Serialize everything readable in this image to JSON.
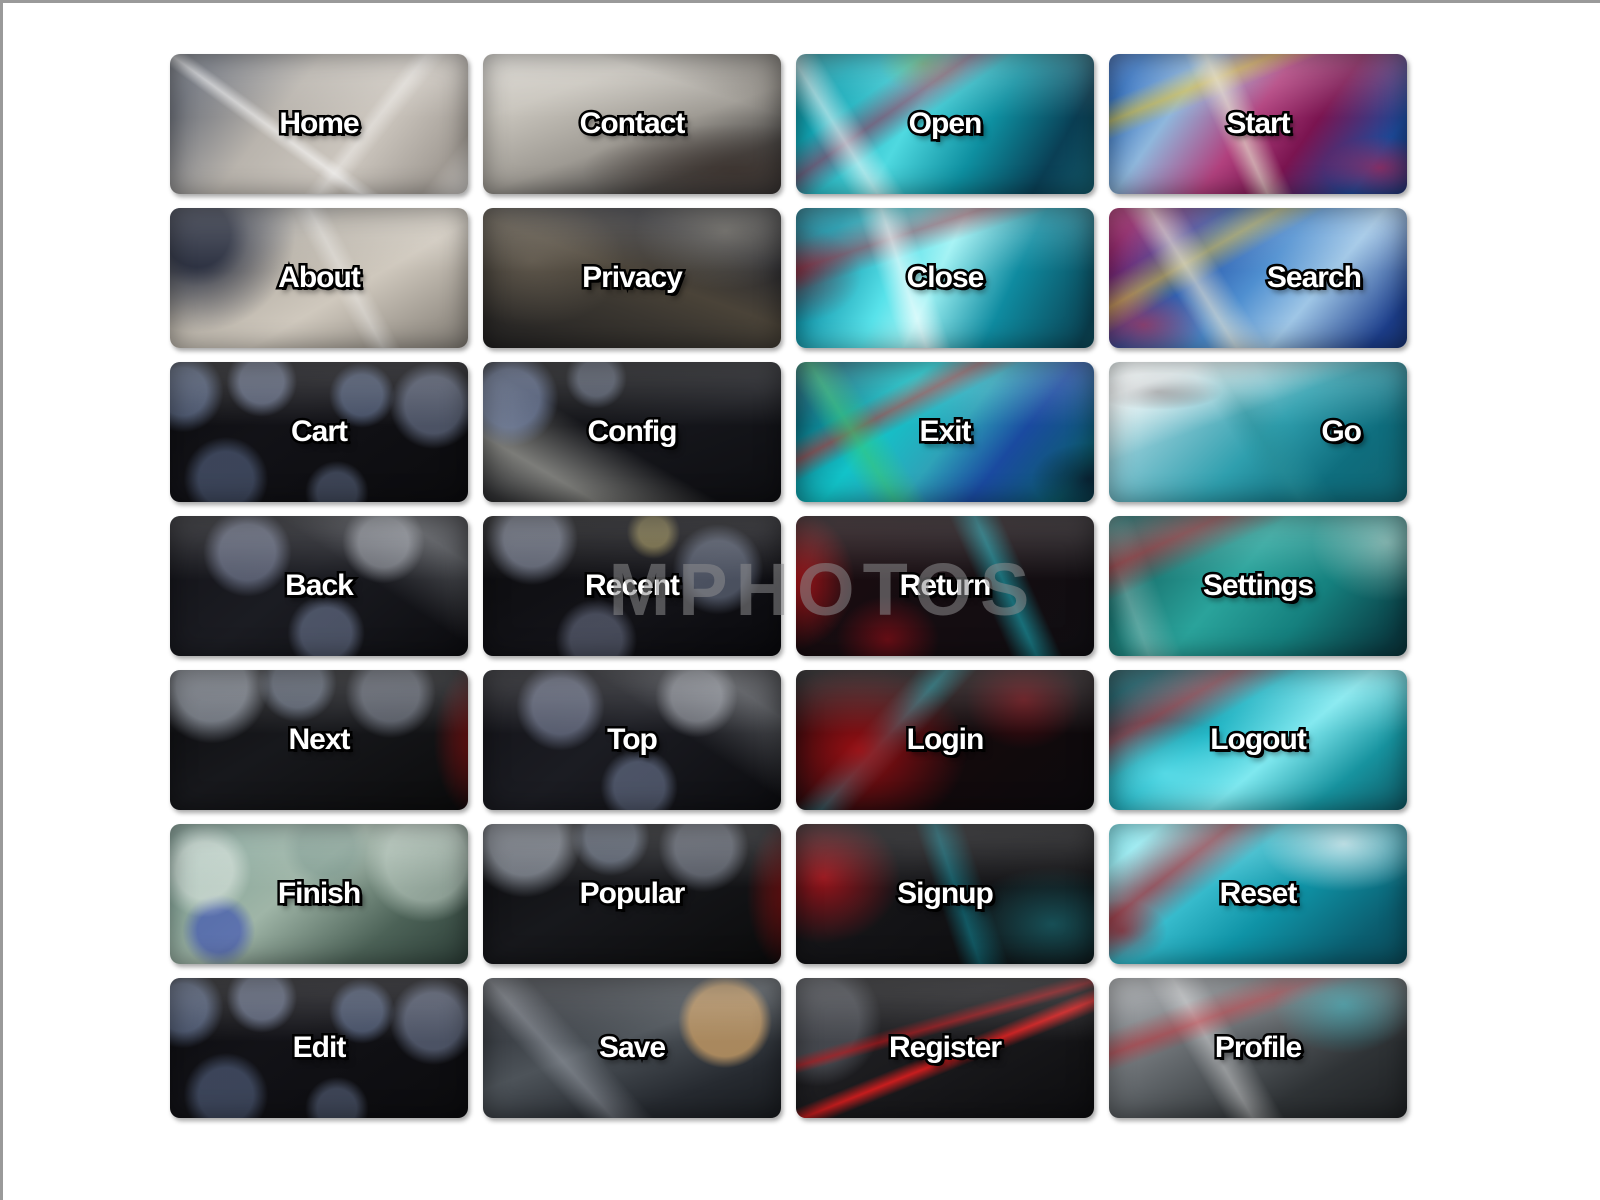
{
  "page": {
    "title": "Web Navigation Button Set",
    "background_color": "#ffffff",
    "border_color": "#9a9a9a",
    "text_color": "#ffffff",
    "text_outline_color": "#000000",
    "columns": 4,
    "rows": 7,
    "button_count": 28
  },
  "watermark": {
    "text": "MPHOTOS",
    "color": "#8c8c8e"
  },
  "buttons": [
    {
      "label": "Home",
      "row": 1,
      "col": 1,
      "texture": "t-key1",
      "align": "al-center"
    },
    {
      "label": "Contact",
      "row": 1,
      "col": 2,
      "texture": "t-key2",
      "align": "al-center"
    },
    {
      "label": "Open",
      "row": 1,
      "col": 3,
      "texture": "t-cy1",
      "align": "al-center"
    },
    {
      "label": "Start",
      "row": 1,
      "col": 4,
      "texture": "t-mg1",
      "align": "al-center"
    },
    {
      "label": "About",
      "row": 2,
      "col": 1,
      "texture": "t-key3",
      "align": "al-center"
    },
    {
      "label": "Privacy",
      "row": 2,
      "col": 2,
      "texture": "t-key4",
      "align": "al-center"
    },
    {
      "label": "Close",
      "row": 2,
      "col": 3,
      "texture": "t-cy2",
      "align": "al-center"
    },
    {
      "label": "Search",
      "row": 2,
      "col": 4,
      "texture": "t-mg2",
      "align": "al-rightin"
    },
    {
      "label": "Cart",
      "row": 3,
      "col": 1,
      "texture": "t-dk1",
      "align": "al-center"
    },
    {
      "label": "Config",
      "row": 3,
      "col": 2,
      "texture": "t-dk2",
      "align": "al-center"
    },
    {
      "label": "Exit",
      "row": 3,
      "col": 3,
      "texture": "t-cy3",
      "align": "al-center"
    },
    {
      "label": "Go",
      "row": 3,
      "col": 4,
      "texture": "t-cy4",
      "align": "al-rightin"
    },
    {
      "label": "Back",
      "row": 4,
      "col": 1,
      "texture": "t-dk3",
      "align": "al-center"
    },
    {
      "label": "Recent",
      "row": 4,
      "col": 2,
      "texture": "t-dk4",
      "align": "al-center"
    },
    {
      "label": "Return",
      "row": 4,
      "col": 3,
      "texture": "t-rd1",
      "align": "al-center"
    },
    {
      "label": "Settings",
      "row": 4,
      "col": 4,
      "texture": "t-cy5",
      "align": "al-center"
    },
    {
      "label": "Next",
      "row": 5,
      "col": 1,
      "texture": "t-gm2",
      "align": "al-center"
    },
    {
      "label": "Top",
      "row": 5,
      "col": 2,
      "texture": "t-dk3",
      "align": "al-center"
    },
    {
      "label": "Login",
      "row": 5,
      "col": 3,
      "texture": "t-rd2",
      "align": "al-center"
    },
    {
      "label": "Logout",
      "row": 5,
      "col": 4,
      "texture": "t-cy6",
      "align": "al-center"
    },
    {
      "label": "Finish",
      "row": 6,
      "col": 1,
      "texture": "t-gm1",
      "align": "al-center"
    },
    {
      "label": "Popular",
      "row": 6,
      "col": 2,
      "texture": "t-gm2",
      "align": "al-center"
    },
    {
      "label": "Signup",
      "row": 6,
      "col": 3,
      "texture": "t-rd4",
      "align": "al-center"
    },
    {
      "label": "Reset",
      "row": 6,
      "col": 4,
      "texture": "t-cy7",
      "align": "al-center"
    },
    {
      "label": "Edit",
      "row": 7,
      "col": 1,
      "texture": "t-dk1",
      "align": "al-center"
    },
    {
      "label": "Save",
      "row": 7,
      "col": 2,
      "texture": "t-sv2",
      "align": "al-center"
    },
    {
      "label": "Register",
      "row": 7,
      "col": 3,
      "texture": "t-rd3",
      "align": "al-center"
    },
    {
      "label": "Profile",
      "row": 7,
      "col": 4,
      "texture": "t-sv1",
      "align": "al-center"
    }
  ]
}
